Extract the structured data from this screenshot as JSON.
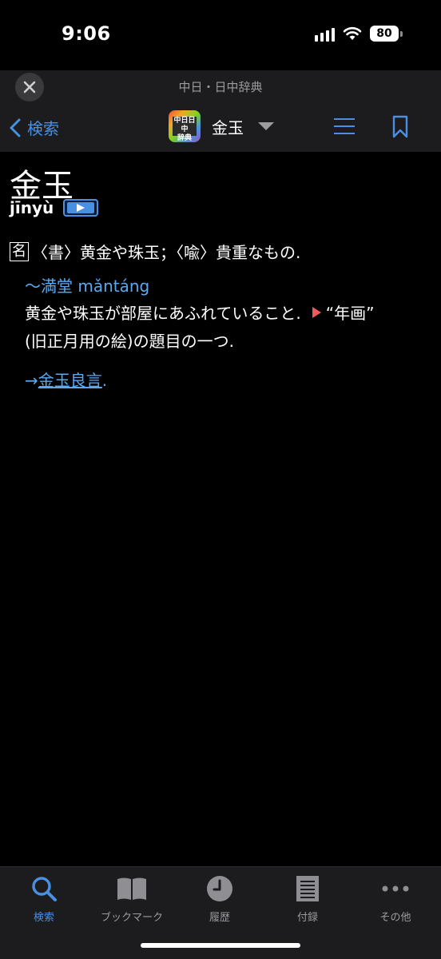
{
  "status": {
    "time": "9:06",
    "battery": "80"
  },
  "nav": {
    "subtitle": "中日・日中辞典",
    "back_label": "検索",
    "title": "金玉",
    "logo_text_top": "中日日中",
    "logo_text_bottom": "辞典"
  },
  "entry": {
    "headword": "金玉",
    "pinyin": "jīnyù",
    "pos": "名",
    "definition": "〈書〉黄金や珠玉；〈喩〉貴重なもの.",
    "idiom": "〜満堂 mǎntáng",
    "idiom_def_1a": "黄金や珠玉が部屋にあふれていること.",
    "idiom_def_1b": "“年画”",
    "idiom_def_2": "(旧正月用の絵)の題目の一つ.",
    "xref_arrow": "→",
    "xref_link": "金玉良言",
    "xref_tail": "."
  },
  "tabs": [
    {
      "label": "検索",
      "icon": "search-icon",
      "active": true
    },
    {
      "label": "ブックマーク",
      "icon": "book-icon",
      "active": false
    },
    {
      "label": "履歴",
      "icon": "clock-icon",
      "active": false
    },
    {
      "label": "付録",
      "icon": "document-icon",
      "active": false
    },
    {
      "label": "その他",
      "icon": "more-icon",
      "active": false
    }
  ],
  "colors": {
    "accent": "#4a90e2",
    "link": "#5aa9f0",
    "background": "#000000",
    "bar": "#1c1c1e"
  }
}
